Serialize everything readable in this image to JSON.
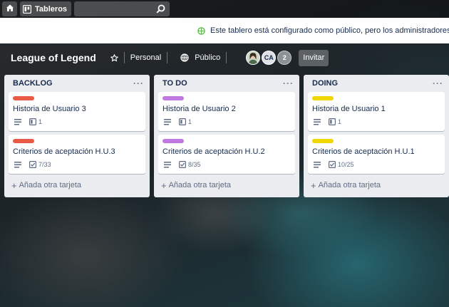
{
  "topbar": {
    "boards_label": "Tableros",
    "search_placeholder": ""
  },
  "banner": {
    "text": "Este tablero está configurado como público, pero los administradores"
  },
  "board": {
    "title": "League of Legend",
    "team": "Personal",
    "visibility": "Público",
    "members": [
      {
        "type": "photo"
      },
      {
        "initials": "CA"
      }
    ],
    "extra_members": "2",
    "invite_label": "Invitar"
  },
  "lists": [
    {
      "title": "BACKLOG",
      "add_label": "Añada otra tarjeta",
      "cards": [
        {
          "label_color": "#eb5a46",
          "title": "Historia de Usuario 3",
          "attachments": "1"
        },
        {
          "label_color": "#eb5a46",
          "title": "Criterios de aceptación H.U.3",
          "checklist": "7/33"
        }
      ]
    },
    {
      "title": "TO DO",
      "add_label": "Añada otra tarjeta",
      "cards": [
        {
          "label_color": "#c377e0",
          "title": "Historia de Usuario 2",
          "attachments": "1"
        },
        {
          "label_color": "#c377e0",
          "title": "Criterios de aceptación H.U.2",
          "checklist": "8/35"
        }
      ]
    },
    {
      "title": "DOING",
      "add_label": "Añada otra tarjeta",
      "cards": [
        {
          "label_color": "#f2d600",
          "title": "Historia de Usuario 1",
          "attachments": "1"
        },
        {
          "label_color": "#f2d600",
          "title": "Criterios de aceptación H.U.1",
          "checklist": "10/25"
        }
      ]
    }
  ],
  "colors": {
    "banner_globe": "#61bd4f",
    "list_bg": "#ebecf0"
  }
}
